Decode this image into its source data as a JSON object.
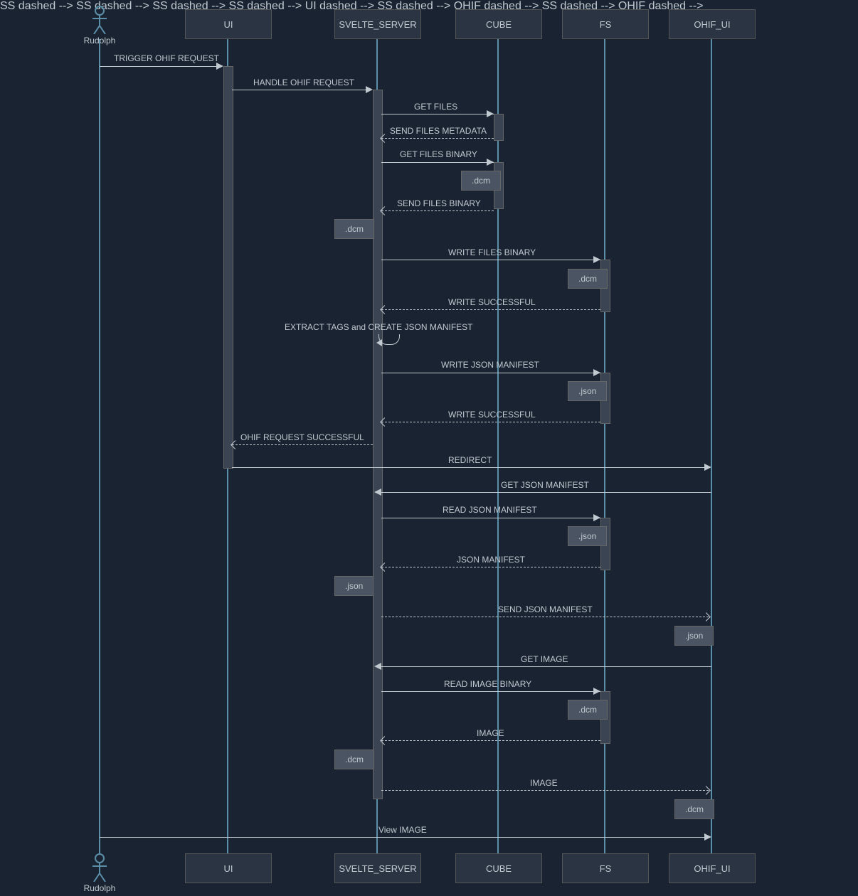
{
  "participants": {
    "actor": "Rudolph",
    "p1": "UI",
    "p2": "SVELTE_SERVER",
    "p3": "CUBE",
    "p4": "FS",
    "p5": "OHIF_UI"
  },
  "messages": {
    "m1": "TRIGGER OHIF REQUEST",
    "m2": "HANDLE OHIF REQUEST",
    "m3": "GET FILES",
    "m4": "SEND FILES METADATA",
    "m5": "GET FILES BINARY",
    "n1": ".dcm",
    "m6": "SEND FILES BINARY",
    "n2": ".dcm",
    "m7": "WRITE FILES BINARY",
    "n3": ".dcm",
    "m8": "WRITE SUCCESSFUL",
    "m9": "EXTRACT TAGS and CREATE JSON MANIFEST",
    "m10": "WRITE JSON MANIFEST",
    "n4": ".json",
    "m11": "WRITE SUCCESSFUL",
    "m12": "OHIF REQUEST SUCCESSFUL",
    "m13": "REDIRECT",
    "m14": "GET JSON MANIFEST",
    "m15": "READ JSON MANIFEST",
    "n5": ".json",
    "m16": "JSON MANIFEST",
    "n6": ".json",
    "m17": "SEND JSON MANIFEST",
    "n7": ".json",
    "m18": "GET IMAGE",
    "m19": "READ IMAGE BINARY",
    "n8": ".dcm",
    "m20": "IMAGE",
    "n9": ".dcm",
    "m21": "IMAGE",
    "n10": ".dcm",
    "m22": "View IMAGE"
  }
}
